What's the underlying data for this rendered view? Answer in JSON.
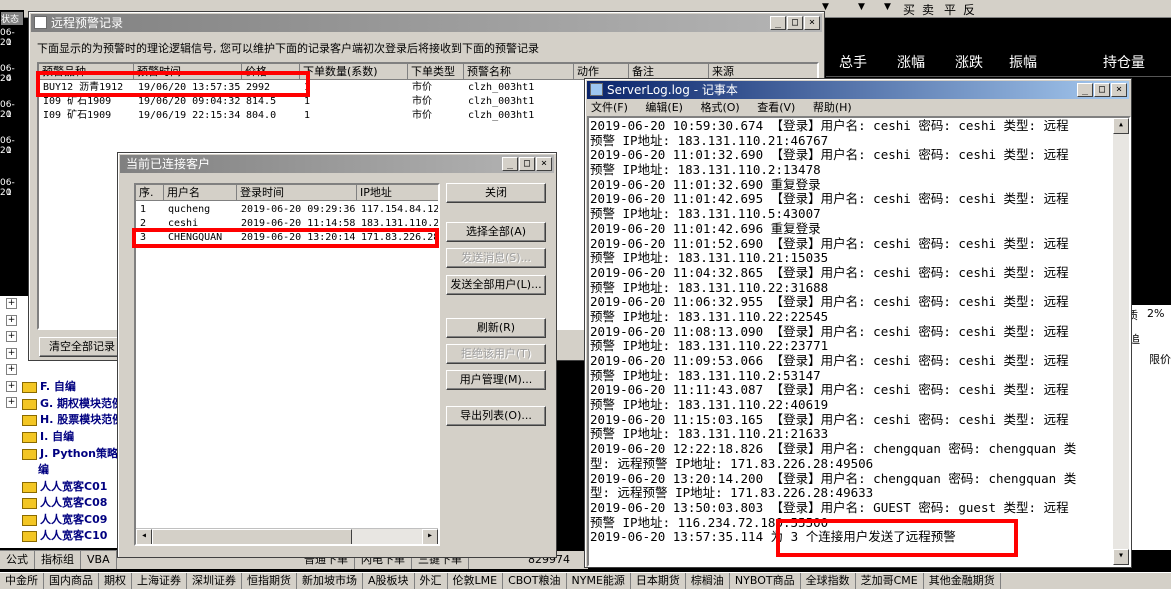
{
  "background": {
    "top_toolbar": [
      "▼",
      "▼",
      "▼",
      "买",
      "卖",
      "平",
      "反"
    ],
    "market_columns": [
      "总手",
      "涨幅",
      "涨跌",
      "振幅",
      "持仓量"
    ],
    "left_status": "状态",
    "left_dates": [
      "06-20",
      "1",
      "06-20",
      "4",
      "06-20",
      "1",
      "06-20",
      "1",
      "06-20",
      "1"
    ],
    "tree_items": [
      "F. 自编",
      "G. 期权模块范例",
      "H. 股票模块范例",
      "I. 自编",
      "J. Python策略范例",
      "编",
      "人人宽客C01",
      "人人宽客C08",
      "人人宽客C09",
      "人人宽客C10"
    ],
    "tree_plus_count": 7,
    "right_stubs": {
      "a": "质",
      "b": "2%",
      "c": "追",
      "d": "限价"
    },
    "bottom_tabs": [
      "公式",
      "指标组",
      "VBA"
    ],
    "order_tabs": [
      "普通下单",
      "闪电下单",
      "三键下单"
    ],
    "order_value": "829974",
    "right_tab": "表",
    "market_tabs": [
      "中金所",
      "国内商品",
      "期权",
      "上海证券",
      "深圳证券",
      "恒指期货",
      "新加坡市场",
      "A股板块",
      "外汇",
      "伦敦LME",
      "CBOT粮油",
      "NYME能源",
      "日本期货",
      "棕榈油",
      "NYBOT商品",
      "全球指数",
      "芝加哥CME",
      "其他金融期货"
    ]
  },
  "alert_window": {
    "title": "远程预警记录",
    "description": "下面显示的为预警时的理论逻辑信号, 您可以维护下面的记录客户端初次登录后将接收到下面的预警记录",
    "columns": [
      "预警品种",
      "预警时间",
      "价格",
      "下单数量(系数)",
      "下单类型",
      "预警名称",
      "动作",
      "备注",
      "来源"
    ],
    "rows": [
      [
        "BUY12 沥青1912",
        "19/06/20 13:57:35",
        "2992",
        "1",
        "市价",
        "clzh_003ht1",
        "",
        "",
        ""
      ],
      [
        "I09 矿石1909",
        "19/06/20 09:04:32",
        "814.5",
        "1",
        "市价",
        "clzh_003ht1",
        "",
        "",
        ""
      ],
      [
        "I09 矿石1909",
        "19/06/19 22:15:34",
        "804.0",
        "1",
        "市价",
        "clzh_003ht1",
        "",
        "",
        ""
      ]
    ],
    "clear_button": "清空全部记录"
  },
  "clients_window": {
    "title": "当前已连接客户",
    "columns": [
      "序.",
      "用户名",
      "登录时间",
      "IP地址"
    ],
    "rows": [
      [
        "1",
        "qucheng",
        "2019-06-20 09:29:36",
        "117.154.84.122"
      ],
      [
        "2",
        "ceshi",
        "2019-06-20 11:14:58",
        "183.131.110.21"
      ],
      [
        "3",
        "CHENGQUAN",
        "2019-06-20 13:20:14",
        "171.83.226.28"
      ]
    ],
    "buttons": {
      "close": "关闭",
      "select_all": "选择全部(A)",
      "send_message": "发送消息(S)...",
      "send_all": "发送全部用户(L)...",
      "refresh": "刷新(R)",
      "deny_user": "拒绝该用户(T)",
      "user_manage": "用户管理(M)...",
      "export_list": "导出列表(O)..."
    }
  },
  "notepad": {
    "title": "ServerLog.log - 记事本",
    "menu": [
      "文件(F)",
      "编辑(E)",
      "格式(O)",
      "查看(V)",
      "帮助(H)"
    ],
    "lines": [
      "2019-06-20 10:59:30.674  【登录】用户名: ceshi 密码: ceshi 类型: 远程",
      "预警 IP地址: 183.131.110.21:46767",
      "2019-06-20 11:01:32.690  【登录】用户名: ceshi 密码: ceshi 类型: 远程",
      "预警 IP地址: 183.131.110.2:13478",
      "2019-06-20 11:01:32.690    重复登录",
      "2019-06-20 11:01:42.695  【登录】用户名: ceshi 密码: ceshi 类型: 远程",
      "预警 IP地址: 183.131.110.5:43007",
      "2019-06-20 11:01:42.696    重复登录",
      "2019-06-20 11:01:52.690  【登录】用户名: ceshi 密码: ceshi 类型: 远程",
      "预警 IP地址: 183.131.110.21:15035",
      "2019-06-20 11:04:32.865  【登录】用户名: ceshi 密码: ceshi 类型: 远程",
      "预警 IP地址: 183.131.110.22:31688",
      "2019-06-20 11:06:32.955  【登录】用户名: ceshi 密码: ceshi 类型: 远程",
      "预警 IP地址: 183.131.110.22:22545",
      "2019-06-20 11:08:13.090  【登录】用户名: ceshi 密码: ceshi 类型: 远程",
      "预警 IP地址: 183.131.110.22:23771",
      "2019-06-20 11:09:53.066  【登录】用户名: ceshi 密码: ceshi 类型: 远程",
      "预警 IP地址: 183.131.110.2:53147",
      "2019-06-20 11:11:43.087  【登录】用户名: ceshi 密码: ceshi 类型: 远程",
      "预警 IP地址: 183.131.110.22:40619",
      "2019-06-20 11:15:03.165  【登录】用户名: ceshi 密码: ceshi 类型: 远程",
      "预警 IP地址: 183.131.110.21:21633",
      "2019-06-20 12:22:18.826  【登录】用户名: chengquan 密码: chengquan 类",
      "型: 远程预警 IP地址: 171.83.226.28:49506",
      "2019-06-20 13:20:14.200  【登录】用户名: chengquan 密码: chengquan 类",
      "型: 远程预警 IP地址: 171.83.226.28:49633",
      "2019-06-20 13:50:03.803  【登录】用户名: GUEST 密码: guest 类型: 远程",
      "预警 IP地址: 116.234.72.180:55500",
      "2019-06-20 13:57:35.114    为 3 个连接用户发送了远程预警"
    ]
  },
  "colors": {
    "highlight": "#ff0000",
    "background_dark": "#000000",
    "title_active": "#0a246a",
    "title_inactive": "#808080"
  }
}
